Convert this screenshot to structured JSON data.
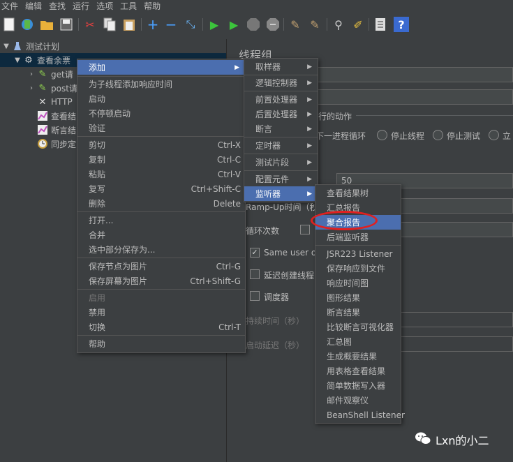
{
  "menubar": {
    "items": [
      "文件",
      "编辑",
      "查找",
      "运行",
      "选项",
      "工具",
      "帮助"
    ]
  },
  "toolbar": {
    "icons": [
      "new-icon",
      "template-icon",
      "open-icon",
      "save-icon",
      "cut-icon",
      "copy-icon",
      "paste-icon",
      "add-icon",
      "remove-icon",
      "toggle-icon",
      "start-icon",
      "start-no-pause-icon",
      "stop-icon",
      "shutdown-icon",
      "clear-icon",
      "clear-all-icon",
      "search-icon",
      "reset-search-icon",
      "function-helper-icon",
      "help-icon"
    ]
  },
  "tree": {
    "root": "测试计划",
    "thread_group": "查看余票",
    "items": [
      "get请",
      "post请",
      "HTTP",
      "查看结",
      "断言结",
      "同步定"
    ]
  },
  "right": {
    "title": "线程组",
    "error_action": "行的动作",
    "radio_next": "下一进程循环",
    "radio_stop_thread": "停止线程",
    "radio_stop_test": "停止测试",
    "radio_stop_now": "立",
    "threads_value": "50",
    "rampup_label": "Ramp-Up时间（秒",
    "loop_label": "循环次数",
    "same_user": "Same user on",
    "delay_create": "延迟创建线程",
    "scheduler": "调度器",
    "duration": "持续时间（秒）",
    "startup_delay": "启动延迟（秒）"
  },
  "context_menu": {
    "items": [
      {
        "label": "添加",
        "key": "",
        "sub": "▶"
      },
      {
        "label": "为子线程添加响应时间",
        "key": ""
      },
      {
        "label": "启动",
        "key": ""
      },
      {
        "label": "不停顿启动",
        "key": ""
      },
      {
        "label": "验证",
        "key": ""
      },
      {
        "label": "剪切",
        "key": "Ctrl-X"
      },
      {
        "label": "复制",
        "key": "Ctrl-C"
      },
      {
        "label": "粘贴",
        "key": "Ctrl-V"
      },
      {
        "label": "复写",
        "key": "Ctrl+Shift-C"
      },
      {
        "label": "删除",
        "key": "Delete"
      },
      {
        "label": "打开...",
        "key": ""
      },
      {
        "label": "合并",
        "key": ""
      },
      {
        "label": "选中部分保存为...",
        "key": ""
      },
      {
        "label": "保存节点为图片",
        "key": "Ctrl-G"
      },
      {
        "label": "保存屏幕为图片",
        "key": "Ctrl+Shift-G"
      },
      {
        "label": "启用",
        "key": ""
      },
      {
        "label": "禁用",
        "key": ""
      },
      {
        "label": "切换",
        "key": "Ctrl-T"
      },
      {
        "label": "帮助",
        "key": ""
      }
    ]
  },
  "add_submenu": {
    "items": [
      "取样器",
      "逻辑控制器",
      "前置处理器",
      "后置处理器",
      "断言",
      "定时器",
      "测试片段",
      "配置元件",
      "监听器"
    ],
    "arrow": "▶"
  },
  "listener_submenu": {
    "items": [
      "查看结果树",
      "汇总报告",
      "聚合报告",
      "后端监听器",
      "JSR223 Listener",
      "保存响应到文件",
      "响应时间图",
      "图形结果",
      "断言结果",
      "比较断言可视化器",
      "汇总图",
      "生成概要结果",
      "用表格查看结果",
      "简单数据写入器",
      "邮件观察仪",
      "BeanShell Listener"
    ]
  },
  "watermark": {
    "text": "Lxn的小二"
  }
}
